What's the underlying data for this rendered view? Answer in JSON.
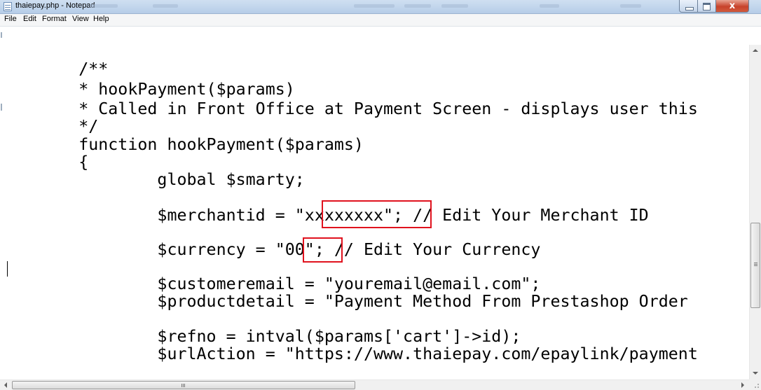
{
  "window": {
    "title": "thaiepay.php - Notepad",
    "close_glyph": "x",
    "colors": {
      "titlebar": "#b9d1ea",
      "close": "#c7422b",
      "highlight_box": "#e0121e"
    }
  },
  "menu": {
    "file": "File",
    "edit": "Edit",
    "format": "Format",
    "view": "View",
    "help": "Help"
  },
  "editor": {
    "lines": [
      "        /**",
      "        * hookPayment($params)",
      "        * Called in Front Office at Payment Screen - displays user this",
      "        */",
      "        function hookPayment($params)",
      "        {",
      "                global $smarty;",
      "",
      "                $merchantid = \"xxxxxxxx\"; // Edit Your Merchant ID",
      "",
      "                $currency = \"00\"; // Edit Your Currency",
      "",
      "                $customeremail = \"youremail@email.com\";",
      "                $productdetail = \"Payment Method From Prestashop Order",
      "",
      "                $refno = intval($params['cart']->id);",
      "                $urlAction = \"https://www.thaiepay.com/epaylink/payment"
    ],
    "highlighted_values": [
      "\"xxxxxxxx\"",
      "\"00\""
    ]
  },
  "icons": {
    "app": "notepad-icon",
    "minimize": "minimize-icon",
    "maximize": "maximize-icon",
    "close": "close-icon",
    "scroll_up": "arrow-up-icon",
    "scroll_down": "arrow-down-icon",
    "scroll_left": "arrow-left-icon",
    "scroll_right": "arrow-right-icon"
  }
}
